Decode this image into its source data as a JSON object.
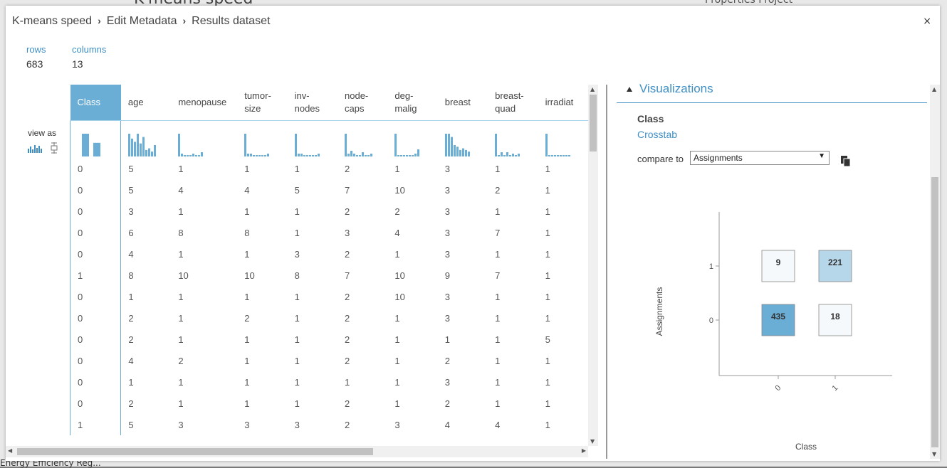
{
  "background": {
    "title": "K-means speed",
    "properties": "Properties   Project",
    "bottom_item": "Energy Efficiency Reg..."
  },
  "breadcrumb": [
    "K-means speed",
    "Edit Metadata",
    "Results dataset"
  ],
  "close_label": "×",
  "stats": {
    "rows_label": "rows",
    "rows_value": "683",
    "columns_label": "columns",
    "columns_value": "13"
  },
  "view_as_label": "view as",
  "table": {
    "columns": [
      "Class",
      "age",
      "menopause",
      "tumor-size",
      "inv-nodes",
      "node-caps",
      "deg-malig",
      "breast",
      "breast-quad",
      "irradiat"
    ],
    "column_display": [
      "Class",
      "age",
      "menopause",
      "tumor-\nsize",
      "inv-\nnodes",
      "node-\ncaps",
      "deg-\nmalig",
      "breast",
      "breast-\nquad",
      "irradiat"
    ],
    "selected_column": "Class",
    "histograms": [
      [
        20,
        12
      ],
      [
        14,
        11,
        9,
        14,
        8,
        12,
        4,
        5,
        3,
        7
      ],
      [
        16,
        2,
        1,
        1,
        1,
        2,
        1,
        1,
        3
      ],
      [
        16,
        2,
        2,
        1,
        1,
        1,
        1,
        1,
        2
      ],
      [
        16,
        2,
        2,
        1,
        1,
        1,
        1,
        1,
        2
      ],
      [
        16,
        2,
        4,
        2,
        1,
        1,
        3,
        1,
        1,
        2
      ],
      [
        16,
        1,
        1,
        1,
        1,
        1,
        1,
        2,
        5
      ],
      [
        14,
        14,
        12,
        7,
        6,
        4,
        5,
        4,
        3
      ],
      [
        16,
        1,
        3,
        1,
        3,
        1,
        2,
        1,
        2
      ],
      [
        16,
        1,
        1,
        1,
        1,
        1,
        1,
        1,
        1
      ]
    ],
    "rows": [
      [
        "0",
        "5",
        "1",
        "1",
        "1",
        "2",
        "1",
        "3",
        "1",
        "1"
      ],
      [
        "0",
        "5",
        "4",
        "4",
        "5",
        "7",
        "10",
        "3",
        "2",
        "1"
      ],
      [
        "0",
        "3",
        "1",
        "1",
        "1",
        "2",
        "2",
        "3",
        "1",
        "1"
      ],
      [
        "0",
        "6",
        "8",
        "8",
        "1",
        "3",
        "4",
        "3",
        "7",
        "1"
      ],
      [
        "0",
        "4",
        "1",
        "1",
        "3",
        "2",
        "1",
        "3",
        "1",
        "1"
      ],
      [
        "1",
        "8",
        "10",
        "10",
        "8",
        "7",
        "10",
        "9",
        "7",
        "1"
      ],
      [
        "0",
        "1",
        "1",
        "1",
        "1",
        "2",
        "10",
        "3",
        "1",
        "1"
      ],
      [
        "0",
        "2",
        "1",
        "2",
        "1",
        "2",
        "1",
        "3",
        "1",
        "1"
      ],
      [
        "0",
        "2",
        "1",
        "1",
        "1",
        "2",
        "1",
        "1",
        "1",
        "5"
      ],
      [
        "0",
        "4",
        "2",
        "1",
        "1",
        "2",
        "1",
        "2",
        "1",
        "1"
      ],
      [
        "0",
        "1",
        "1",
        "1",
        "1",
        "1",
        "1",
        "3",
        "1",
        "1"
      ],
      [
        "0",
        "2",
        "1",
        "1",
        "1",
        "2",
        "1",
        "2",
        "1",
        "1"
      ],
      [
        "1",
        "5",
        "3",
        "3",
        "3",
        "2",
        "3",
        "4",
        "4",
        "1"
      ]
    ]
  },
  "visualizations": {
    "header": "Visualizations",
    "column": "Class",
    "type": "Crosstab",
    "compare_label": "compare to",
    "compare_value": "Assignments"
  },
  "chart_data": {
    "type": "heatmap",
    "xlabel": "Class",
    "ylabel": "Assignments",
    "x_categories": [
      "0",
      "1"
    ],
    "y_categories": [
      "0",
      "1"
    ],
    "cells": [
      {
        "x": "0",
        "y": "1",
        "value": 9
      },
      {
        "x": "1",
        "y": "1",
        "value": 221
      },
      {
        "x": "0",
        "y": "0",
        "value": 435
      },
      {
        "x": "1",
        "y": "0",
        "value": 18
      }
    ],
    "colors": {
      "high": "#6aaed6",
      "mid": "#b6d6ea",
      "low": "#ffffff"
    }
  }
}
